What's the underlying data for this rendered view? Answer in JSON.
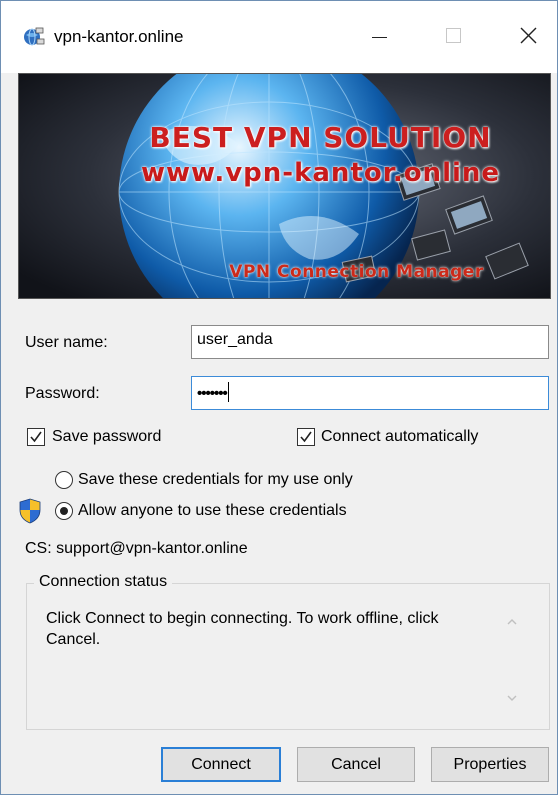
{
  "window": {
    "title": "vpn-kantor.online",
    "controls": {
      "minimize": "minimize",
      "maximize": "maximize",
      "close": "close"
    }
  },
  "banner": {
    "line1": "BEST VPN SOLUTION",
    "line2": "www.vpn-kantor.online",
    "line3": "VPN Connection Manager"
  },
  "form": {
    "username_label": "User name:",
    "username_value": "user_anda",
    "password_label": "Password:",
    "password_masked": "•••••••",
    "save_password_label": "Save password",
    "save_password_checked": true,
    "connect_auto_label": "Connect automatically",
    "connect_auto_checked": true,
    "radio_me_only_label": "Save these credentials for my use only",
    "radio_anyone_label": "Allow anyone to use these credentials",
    "selected_radio": "anyone",
    "cs_text": "CS: support@vpn-kantor.online"
  },
  "status": {
    "group_title": "Connection status",
    "message": "Click Connect to begin connecting.  To work offline, click Cancel."
  },
  "buttons": {
    "connect": "Connect",
    "cancel": "Cancel",
    "properties": "Properties"
  },
  "icons": {
    "app": "vpn-globe-icon",
    "shield": "uac-shield-icon",
    "check": "check-icon",
    "scroll_up": "scroll-up-arrow",
    "scroll_down": "scroll-down-arrow"
  },
  "colors": {
    "focus_blue": "#3c8bd8",
    "default_button_border": "#2a7fd6",
    "banner_text_red": "#cc1f1f"
  }
}
